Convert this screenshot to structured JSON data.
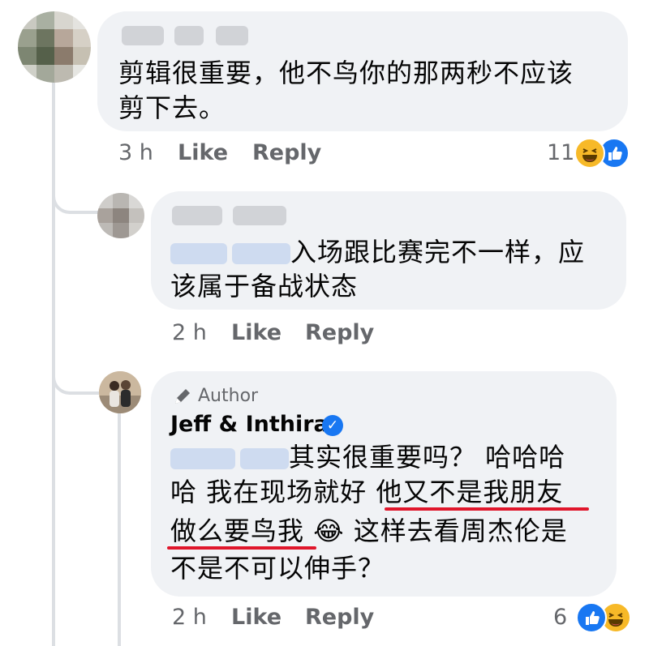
{
  "comments": [
    {
      "time": "3 h",
      "like_label": "Like",
      "reply_label": "Reply",
      "text_line1": "剪辑很重要，他不鸟你的那两秒不应该",
      "text_line2": "剪下去。",
      "reaction_count": "11",
      "reaction_icons": [
        "haha-icon",
        "like-icon"
      ]
    },
    {
      "time": "2 h",
      "like_label": "Like",
      "reply_label": "Reply",
      "text_line1_suffix": "入场跟比赛完不一样，应",
      "text_line2": "该属于备战状态"
    },
    {
      "author_badge": "Author",
      "author_name": "Jeff & Inthira",
      "time": "2 h",
      "like_label": "Like",
      "reply_label": "Reply",
      "text_line1_suffix": "其实很重要吗？ 哈哈哈",
      "text_line2_a": "哈 我在现场就好 ",
      "text_line2_b": "他又不是我朋友",
      "text_line3_a": "做么要鸟我",
      "text_line3_emoji": "😂",
      "text_line3_b": " 这样去看周杰伦是",
      "text_line4": "不是不可以伸手？",
      "reaction_count": "6",
      "reaction_icons": [
        "like-icon",
        "haha-icon"
      ]
    }
  ],
  "colors": {
    "bubble": "#f0f2f5",
    "meta_text": "#65676b",
    "like_blue": "#1877f2",
    "haha_yellow": "#f7b928",
    "underline_red": "#e0162b"
  }
}
